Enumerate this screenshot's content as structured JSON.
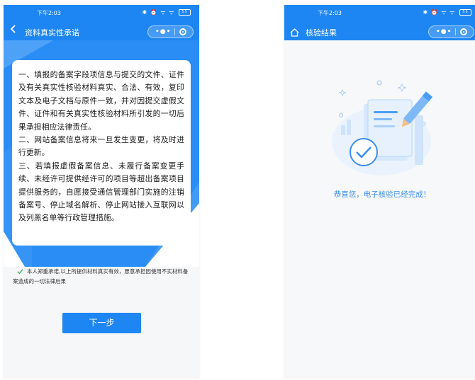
{
  "left_screen": {
    "status": {
      "time": "下午2:03",
      "icons": "✱ ⏰ ᯤ ᯤ",
      "battery": "55"
    },
    "nav": {
      "back_icon": "chevron-left-icon",
      "title": "资料真实性承诺"
    },
    "capsule": {
      "menu": "•●•"
    },
    "commitment": {
      "p1": "一、填报的备案字段项信息与提交的文件、证件及有关真实性核验材料真实、合法、有效，复印文本及电子文档与原件一致，并对因提交虚假文件、证件和有关真实性核验材料所引发的一切后果承担相应法律责任。",
      "p2": "二、网站备案信息将来一旦发生变更，将及时进行更新。",
      "p3": "三、若填报虚假备案信息、未履行备案变更手续、未经许可提供经许可的项目等超出备案项目提供服务的，自愿接受通信管理部门实施的注销备案号、停止域名解析、停止网站接入互联网以及列黑名单等行政管理措施。"
    },
    "agreement": {
      "checked": true,
      "text": "本人郑重承诺,以上所提供材料真实有效，愿意承担因使用不实材料备案造成的一切法律后果"
    },
    "next_button": "下一步"
  },
  "right_screen": {
    "status": {
      "time": "下午2:03",
      "icons": "✱ ⏰ ᯤ ᯤ",
      "battery": "55"
    },
    "nav": {
      "home_icon": "home-icon",
      "title": "核验结果"
    },
    "capsule": {
      "menu": "•●•"
    },
    "illustration_icon": "document-checked-icon",
    "message": "恭喜您，电子核验已经完成！"
  },
  "colors": {
    "primary": "#1e86f2",
    "message": "#3b8ef0"
  }
}
